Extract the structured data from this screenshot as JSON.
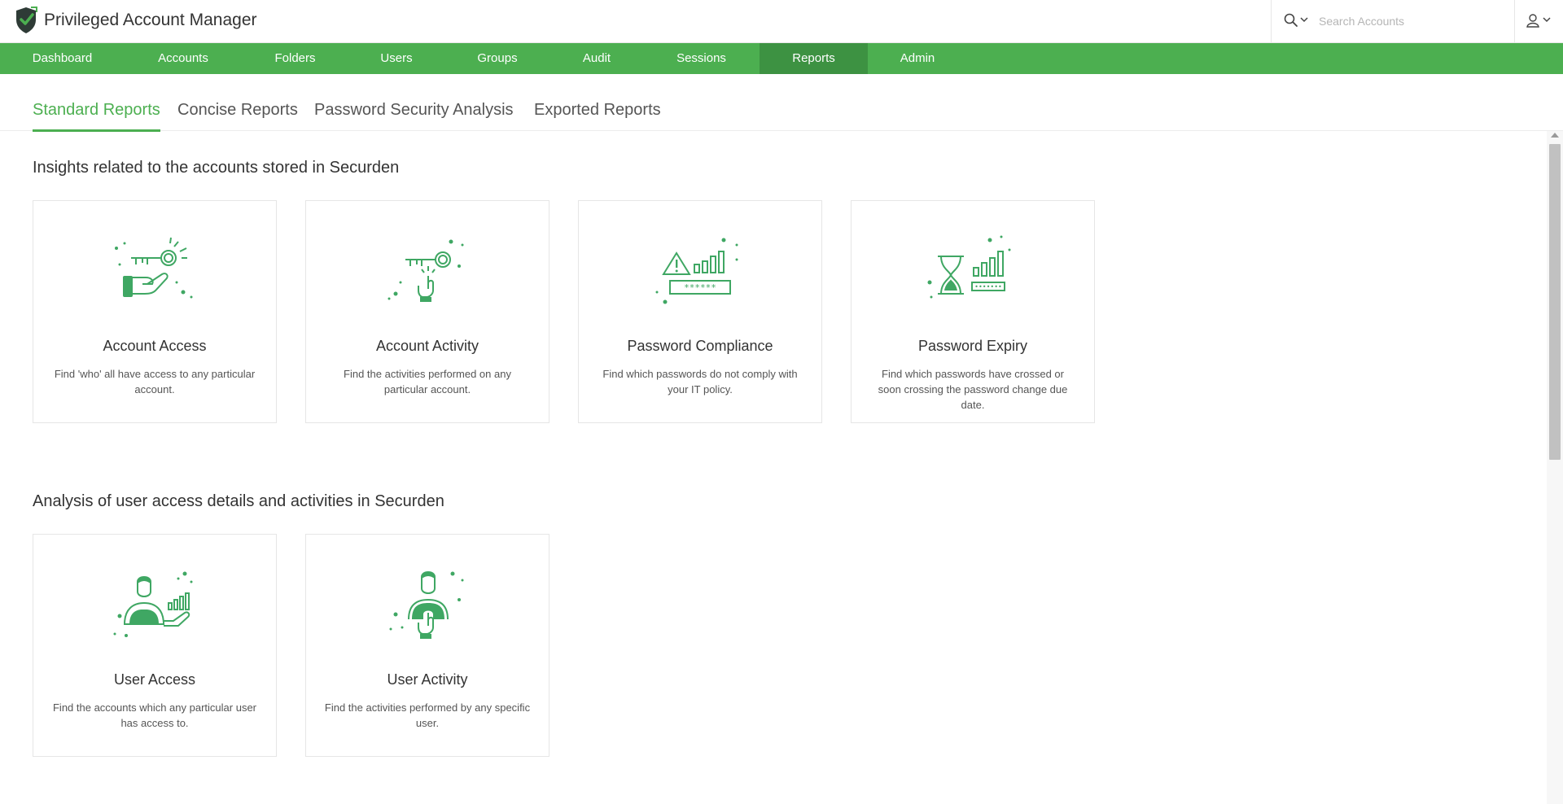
{
  "app": {
    "title": "Privileged Account Manager"
  },
  "search": {
    "placeholder": "Search Accounts"
  },
  "nav": {
    "items": [
      {
        "label": "Dashboard"
      },
      {
        "label": "Accounts"
      },
      {
        "label": "Folders"
      },
      {
        "label": "Users"
      },
      {
        "label": "Groups"
      },
      {
        "label": "Audit"
      },
      {
        "label": "Sessions"
      },
      {
        "label": "Reports",
        "active": true
      },
      {
        "label": "Admin"
      }
    ]
  },
  "tabs": [
    {
      "label": "Standard Reports",
      "active": true
    },
    {
      "label": "Concise Reports"
    },
    {
      "label": "Password Security Analysis"
    },
    {
      "label": "Exported Reports"
    }
  ],
  "sections": [
    {
      "title": "Insights related to the accounts stored in Securden",
      "cards": [
        {
          "title": "Account Access",
          "description": "Find 'who' all have access to any particular account.",
          "icon": "key-hand-icon"
        },
        {
          "title": "Account Activity",
          "description": "Find the activities performed on any particular account.",
          "icon": "key-click-icon"
        },
        {
          "title": "Password Compliance",
          "description": "Find which passwords do not comply with your IT policy.",
          "icon": "warning-password-icon"
        },
        {
          "title": "Password Expiry",
          "description": "Find which passwords have crossed or soon crossing the password change due date.",
          "icon": "hourglass-password-icon"
        }
      ]
    },
    {
      "title": "Analysis of user access details and activities in Securden",
      "cards": [
        {
          "title": "User Access",
          "description": "Find the accounts which any particular user has access to.",
          "icon": "user-access-icon"
        },
        {
          "title": "User Activity",
          "description": "Find the activities performed by any specific user.",
          "icon": "user-click-icon"
        }
      ]
    }
  ],
  "colors": {
    "brand_green": "#4caf50",
    "nav_active": "#3d9242",
    "icon_green": "#3fa763"
  }
}
